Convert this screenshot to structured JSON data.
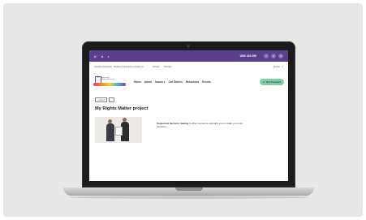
{
  "topbar": {
    "icon1": "A⁻",
    "icon2": "A",
    "icon3": "◐",
    "phone": "1800 424 065",
    "social": [
      "f",
      "in",
      "✉"
    ]
  },
  "util": {
    "items": [
      "Assistant Members",
      "Website & Enquiries",
      "Contact Us",
      "Donate",
      "Podcast"
    ],
    "search_label": "Search"
  },
  "logo": {
    "box_text": "ara",
    "line1": "Australian",
    "line2": "Rights Advocacy"
  },
  "nav": {
    "items": [
      "Home",
      "About",
      "Issues ▾",
      "Our Stories",
      "Resources",
      "Events"
    ],
    "cta": "Get Involved"
  },
  "crumb": {
    "home": "⌂ Home",
    "sep": "›"
  },
  "page": {
    "title": "My Rights Matter project",
    "desc_bold": "Supported decision making",
    "desc_rest": " is when someone supports you to make your own decisions."
  },
  "colors": {
    "topbar": "#5a3f8f",
    "cta": "#7fd0a3"
  }
}
